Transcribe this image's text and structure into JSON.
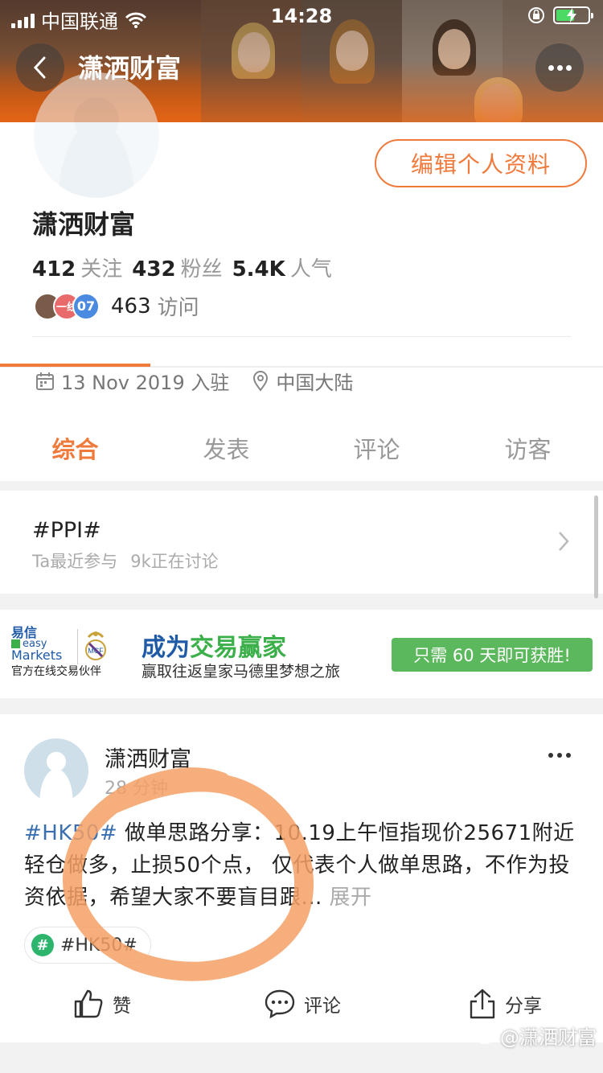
{
  "status_bar": {
    "carrier": "中国联通",
    "time": "14:28"
  },
  "nav": {
    "title": "潇洒财富"
  },
  "profile": {
    "edit_label": "编辑个人资料",
    "name": "潇洒财富",
    "following_count": "412",
    "following_label": "关注",
    "followers_count": "432",
    "followers_label": "粉丝",
    "popularity_count": "5.4K",
    "popularity_label": "人气",
    "visitor_badge_1": "一线",
    "visitor_badge_2": "07",
    "visits_count": "463",
    "visits_label": "访问",
    "join_date": "13 Nov 2019 入驻",
    "location": "中国大陆"
  },
  "tabs": [
    "综合",
    "发表",
    "评论",
    "访客"
  ],
  "topic": {
    "tag": "#PPI#",
    "participated": "Ta最近参与",
    "discussing": "9k正在讨论"
  },
  "ad": {
    "logo_cn": "易信",
    "logo_easy": "easy",
    "logo_markets": "Markets",
    "partner": "官方在线交易伙伴",
    "title_part1": "成为",
    "title_part2": "交易赢家",
    "subtitle": "赢取往返皇家马德里梦想之旅",
    "cta": "只需 60 天即可获胜!"
  },
  "post": {
    "author": "潇洒财富",
    "time": "28 分钟",
    "hashtag": "#HK50#",
    "text": " 做单思路分享：10.19上午恒指现价25671附近轻仓做多，止损50个点， 仅代表个人做单思路，不作为投资依据，希望大家不要盲目跟...",
    "expand": " 展开",
    "chip": "#HK50#",
    "like": "赞",
    "comment": "评论",
    "share": "分享"
  },
  "watermark": "@潇洒财富",
  "colors": {
    "accent": "#f07a3c",
    "hashtag": "#3a6fb0",
    "ad_green": "#5cb85c",
    "annotation": "#f5a066"
  }
}
